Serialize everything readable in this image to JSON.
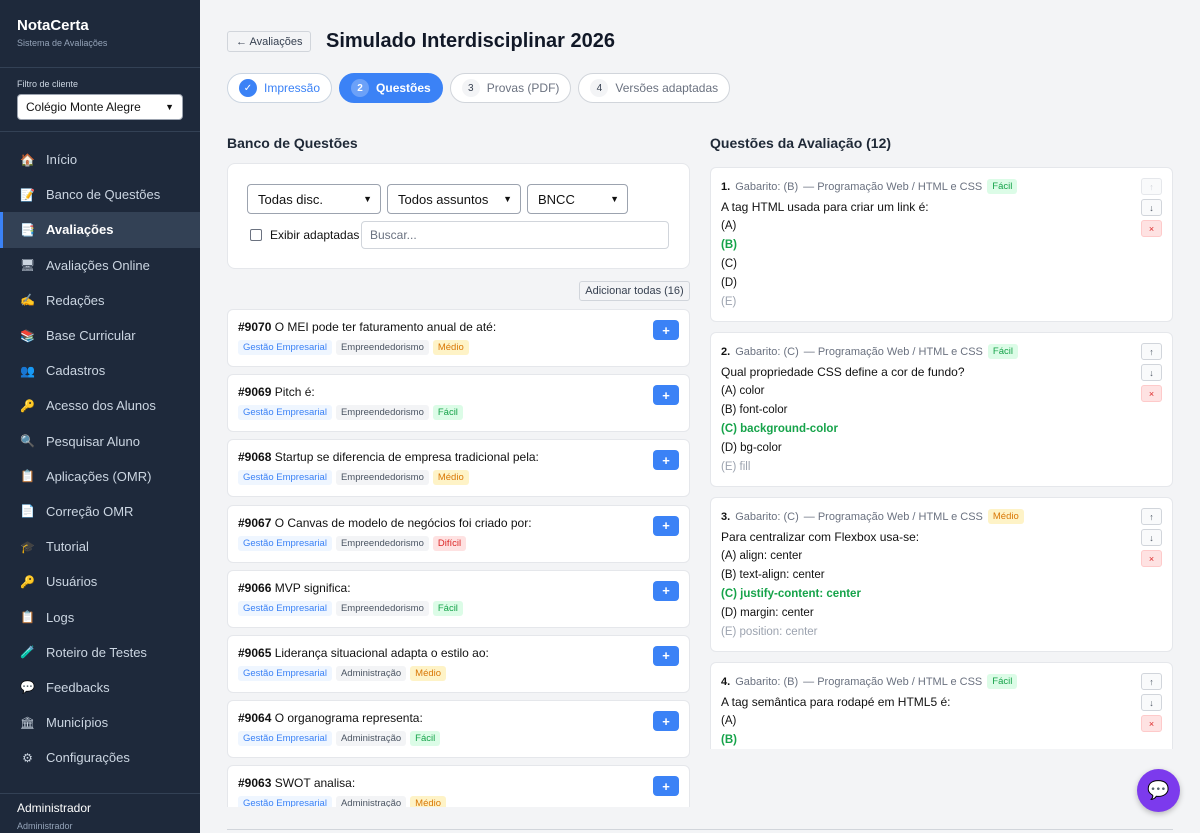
{
  "app": {
    "name": "NotaCerta",
    "subtitle": "Sistema de Avaliações"
  },
  "client_filter": {
    "label": "Filtro de cliente",
    "value": "Colégio Monte Alegre"
  },
  "nav": [
    {
      "label": "Início",
      "icon": "home-icon",
      "glyph": "🏠"
    },
    {
      "label": "Banco de Questões",
      "icon": "memo-icon",
      "glyph": "📝"
    },
    {
      "label": "Avaliações",
      "icon": "document-icon",
      "glyph": "📑",
      "active": true
    },
    {
      "label": "Avaliações Online",
      "icon": "monitor-icon",
      "glyph": "🖥"
    },
    {
      "label": "Redações",
      "icon": "writing-hand-icon",
      "glyph": "✍"
    },
    {
      "label": "Base Curricular",
      "icon": "books-icon",
      "glyph": "📚"
    },
    {
      "label": "Cadastros",
      "icon": "people-icon",
      "glyph": "👥"
    },
    {
      "label": "Acesso dos Alunos",
      "icon": "key-icon",
      "glyph": "🔑"
    },
    {
      "label": "Pesquisar Aluno",
      "icon": "magnifier-icon",
      "glyph": "🔍"
    },
    {
      "label": "Aplicações (OMR)",
      "icon": "clipboard-icon",
      "glyph": "📋"
    },
    {
      "label": "Correção OMR",
      "icon": "page-icon",
      "glyph": "📄"
    },
    {
      "label": "Tutorial",
      "icon": "graduation-cap-icon",
      "glyph": "🎓"
    },
    {
      "label": "Usuários",
      "icon": "key-icon",
      "glyph": "🔑"
    },
    {
      "label": "Logs",
      "icon": "clipboard-icon",
      "glyph": "📋"
    },
    {
      "label": "Roteiro de Testes",
      "icon": "test-tube-icon",
      "glyph": "🧪"
    },
    {
      "label": "Feedbacks",
      "icon": "speech-bubble-icon",
      "glyph": "💬"
    },
    {
      "label": "Municípios",
      "icon": "building-icon",
      "glyph": "🏛"
    },
    {
      "label": "Configurações",
      "icon": "gear-icon",
      "glyph": "⚙"
    }
  ],
  "user": {
    "name": "Administrador",
    "role": "Administrador"
  },
  "header": {
    "back_label": "← Avaliações",
    "title": "Simulado Interdisciplinar 2026"
  },
  "steps": [
    {
      "num": "✓",
      "label": "Impressão",
      "state": "done"
    },
    {
      "num": "2",
      "label": "Questões",
      "state": "active"
    },
    {
      "num": "3",
      "label": "Provas (PDF)",
      "state": "todo"
    },
    {
      "num": "4",
      "label": "Versões adaptadas",
      "state": "todo"
    }
  ],
  "bank": {
    "title": "Banco de Questões",
    "filters": {
      "discipline": "Todas disc.",
      "subject": "Todos assuntos",
      "standard": "BNCC",
      "adapted_label": "Exibir adaptadas",
      "search_placeholder": "Buscar..."
    },
    "add_all_label": "Adicionar todas (16)",
    "add_label": "+",
    "questions": [
      {
        "id": "#9070",
        "text": "O MEI pode ter faturamento anual de até:",
        "area": "Gestão Empresarial",
        "topic": "Empreendedorismo",
        "level": "Médio"
      },
      {
        "id": "#9069",
        "text": "Pitch é:",
        "area": "Gestão Empresarial",
        "topic": "Empreendedorismo",
        "level": "Fácil"
      },
      {
        "id": "#9068",
        "text": "Startup se diferencia de empresa tradicional pela:",
        "area": "Gestão Empresarial",
        "topic": "Empreendedorismo",
        "level": "Médio"
      },
      {
        "id": "#9067",
        "text": "O Canvas de modelo de negócios foi criado por:",
        "area": "Gestão Empresarial",
        "topic": "Empreendedorismo",
        "level": "Difícil"
      },
      {
        "id": "#9066",
        "text": "MVP significa:",
        "area": "Gestão Empresarial",
        "topic": "Empreendedorismo",
        "level": "Fácil"
      },
      {
        "id": "#9065",
        "text": "Liderança situacional adapta o estilo ao:",
        "area": "Gestão Empresarial",
        "topic": "Administração",
        "level": "Médio"
      },
      {
        "id": "#9064",
        "text": "O organograma representa:",
        "area": "Gestão Empresarial",
        "topic": "Administração",
        "level": "Fácil"
      },
      {
        "id": "#9063",
        "text": "SWOT analisa:",
        "area": "Gestão Empresarial",
        "topic": "Administração",
        "level": "Médio"
      }
    ]
  },
  "assessment": {
    "title": "Questões da Avaliação (12)",
    "controls": {
      "up": "↑",
      "down": "↓",
      "remove": "×"
    },
    "questions": [
      {
        "num": "1.",
        "answer": "Gabarito: (B)",
        "area": "— Programação Web / HTML e CSS",
        "level": "Fácil",
        "statement": "A tag HTML usada para criar um link é:",
        "correct": 1,
        "options": [
          "(A)",
          "(B)",
          "(C)",
          "(D)",
          "(E)"
        ]
      },
      {
        "num": "2.",
        "answer": "Gabarito: (C)",
        "area": "— Programação Web / HTML e CSS",
        "level": "Fácil",
        "statement": "Qual propriedade CSS define a cor de fundo?",
        "correct": 2,
        "options": [
          "(A) color",
          "(B) font-color",
          "(C) background-color",
          "(D) bg-color",
          "(E) fill"
        ]
      },
      {
        "num": "3.",
        "answer": "Gabarito: (C)",
        "area": "— Programação Web / HTML e CSS",
        "level": "Médio",
        "statement": "Para centralizar com Flexbox usa-se:",
        "correct": 2,
        "options": [
          "(A) align: center",
          "(B) text-align: center",
          "(C) justify-content: center",
          "(D) margin: center",
          "(E) position: center"
        ]
      },
      {
        "num": "4.",
        "answer": "Gabarito: (B)",
        "area": "— Programação Web / HTML e CSS",
        "level": "Fácil",
        "statement": "A tag semântica para rodapé em HTML5 é:",
        "correct": 1,
        "options": [
          "(A)",
          "(B)"
        ]
      }
    ]
  },
  "chat": {
    "icon": "chat-icon",
    "glyph": "💬"
  }
}
